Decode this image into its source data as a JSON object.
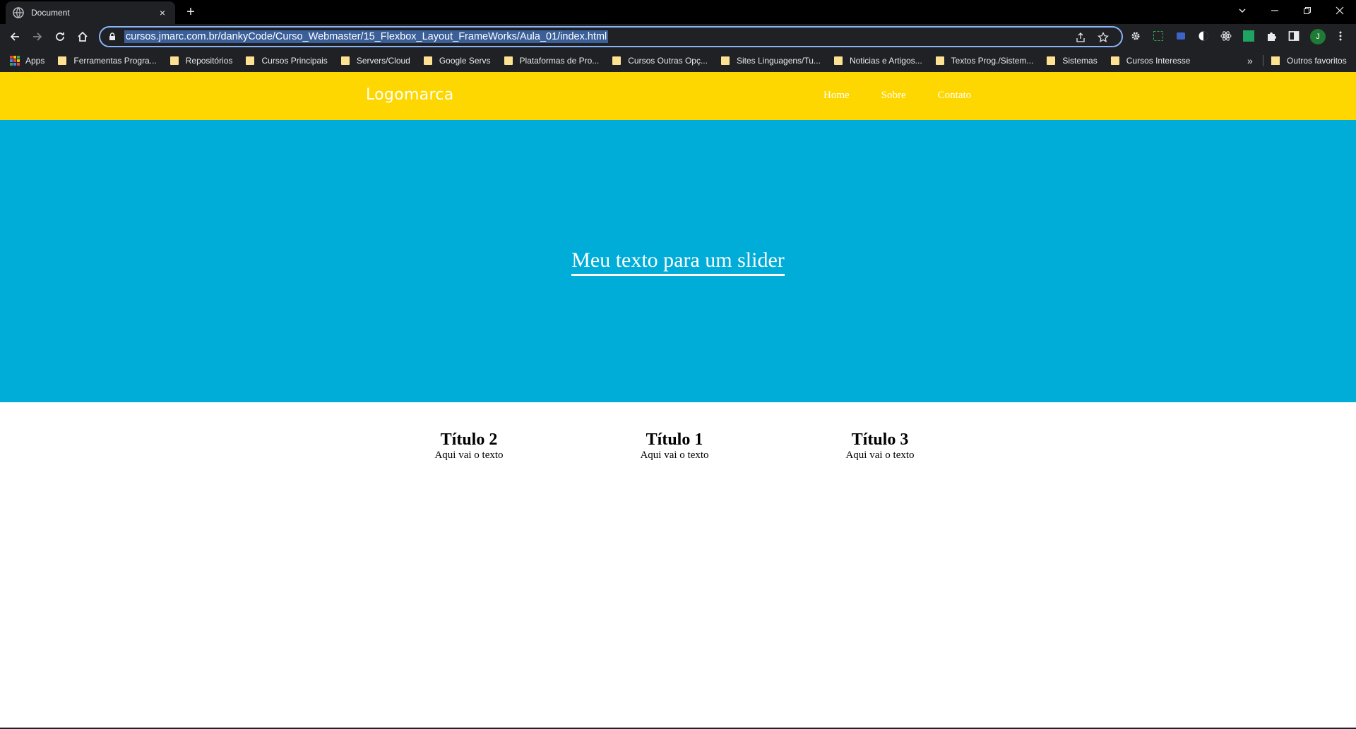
{
  "browser": {
    "tab_title": "Document",
    "tab_close": "×",
    "new_tab": "+",
    "url": "cursos.jmarc.com.br/dankyCode/Curso_Webmaster/15_Flexbox_Layout_FrameWorks/Aula_01/index.html",
    "profile_initial": "J",
    "bookmarks": [
      "Apps",
      "Ferramentas Progra...",
      "Repositórios",
      "Cursos Principais",
      "Servers/Cloud",
      "Google Servs",
      "Plataformas de Pro...",
      "Cursos Outras Opç...",
      "Sites Linguagens/Tu...",
      "Noticias e Artigos...",
      "Textos Prog./Sistem...",
      "Sistemas",
      "Cursos Interesse"
    ],
    "bookmarks_more": "»",
    "other_bookmarks": "Outros favoritos"
  },
  "site": {
    "logo": "Logomarca",
    "menu": [
      "Home",
      "Sobre",
      "Contato"
    ],
    "slider_text": "Meu texto para um slider",
    "boxes": [
      {
        "title": "Título 2",
        "text": "Aqui vai o texto"
      },
      {
        "title": "Título 1",
        "text": "Aqui vai o texto"
      },
      {
        "title": "Título 3",
        "text": "Aqui vai o texto"
      }
    ]
  },
  "colors": {
    "header": "#ffd700",
    "slider": "#00acd8",
    "chrome_bg": "#202124",
    "accent": "#8ab4f8"
  }
}
